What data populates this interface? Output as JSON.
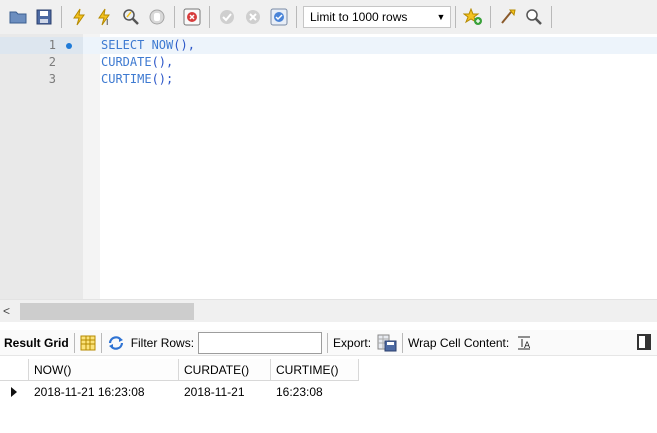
{
  "toolbar": {
    "buttons": [
      {
        "name": "open-folder-icon"
      },
      {
        "name": "save-icon"
      },
      {
        "name": "execute-icon"
      },
      {
        "name": "execute-current-icon"
      },
      {
        "name": "explain-icon"
      },
      {
        "name": "stop-icon"
      },
      {
        "name": "toggle-error-icon"
      },
      {
        "name": "commit-icon"
      },
      {
        "name": "rollback-icon"
      },
      {
        "name": "autocommit-icon"
      }
    ],
    "limit_select": "Limit to 1000 rows",
    "right_icons": [
      "add-snippet-icon",
      "beautify-icon",
      "find-icon"
    ]
  },
  "editor": {
    "line_numbers": [
      "1",
      "2",
      "3"
    ],
    "lines": [
      {
        "fn": "SELECT NOW",
        "rest": "(),"
      },
      {
        "fn": "CURDATE",
        "rest": "(),"
      },
      {
        "fn": "CURTIME",
        "rest": "();"
      }
    ]
  },
  "results_toolbar": {
    "result_grid_label": "Result Grid",
    "filter_label": "Filter Rows:",
    "filter_value": "",
    "export_label": "Export:",
    "wrap_label": "Wrap Cell Content:"
  },
  "grid": {
    "columns": [
      "NOW()",
      "CURDATE()",
      "CURTIME()"
    ],
    "rows": [
      [
        "2018-11-21 16:23:08",
        "2018-11-21",
        "16:23:08"
      ]
    ]
  },
  "colors": {
    "keyword": "#3e7ad1",
    "toolbar_bg": "#f0f0f0",
    "gutter_bg": "#e9e9e9"
  }
}
